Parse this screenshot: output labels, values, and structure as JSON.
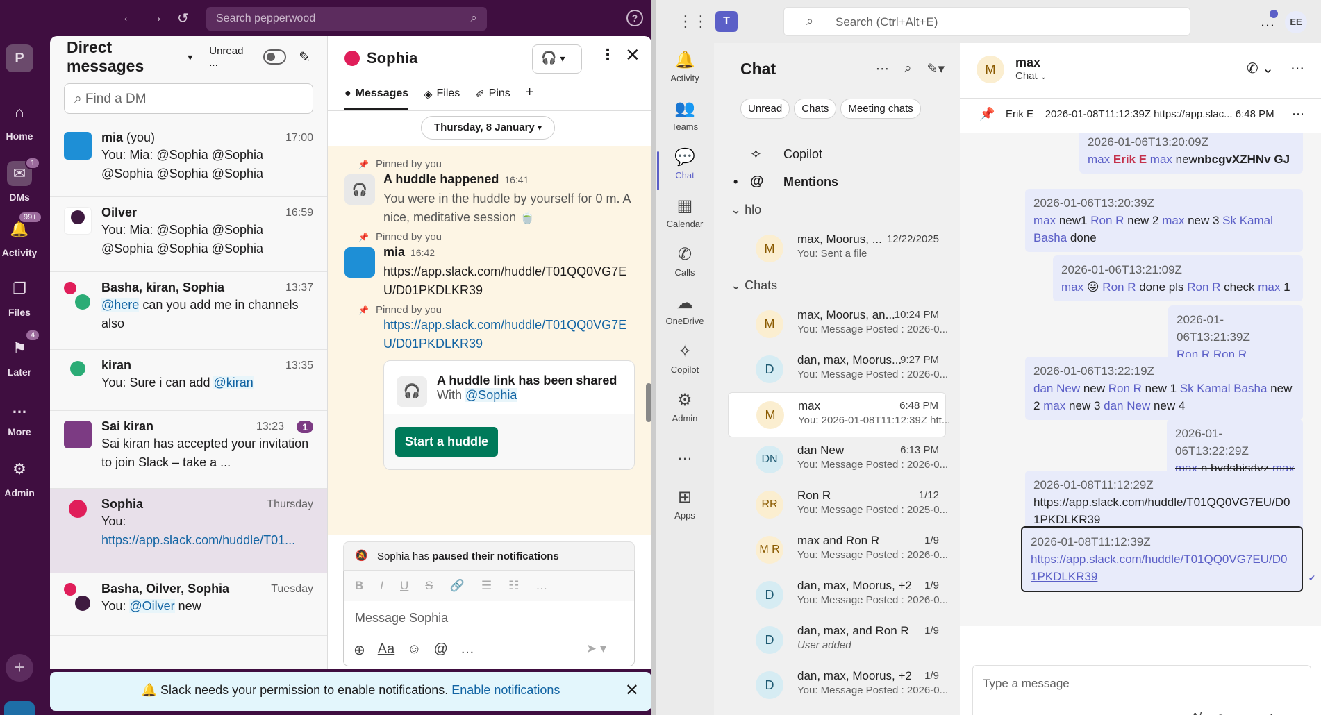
{
  "slack": {
    "search_placeholder": "Search pepperwood",
    "help": "?",
    "workspace_initial": "P",
    "rail": [
      {
        "label": "Home",
        "icon": "home-icon"
      },
      {
        "label": "DMs",
        "icon": "dms-icon",
        "badge": "1"
      },
      {
        "label": "Activity",
        "icon": "bell-icon",
        "badge": "99+"
      },
      {
        "label": "Files",
        "icon": "files-icon"
      },
      {
        "label": "Later",
        "icon": "bookmark-icon",
        "badge": "4"
      },
      {
        "label": "More",
        "icon": "more-icon"
      },
      {
        "label": "Admin",
        "icon": "gear-icon"
      }
    ],
    "dm": {
      "title": "Direct messages",
      "unread_label": "Unread ...",
      "find_placeholder": "Find a DM",
      "rows": [
        {
          "name": "mia",
          "name_suffix": " (you)",
          "time": "17:00",
          "text": "You: Mia: @Sophia @Sophia @Sophia @Sophia @Sophia"
        },
        {
          "name": "Oilver",
          "time": "16:59",
          "text": "You: Mia: @Sophia @Sophia @Sophia @Sophia @Sophia"
        },
        {
          "name": "Basha, kiran, Sophia",
          "time": "13:37",
          "mention": "@here",
          "text": " can you add me in channels also"
        },
        {
          "name": "kiran",
          "time": "13:35",
          "text": "You: Sure i can add ",
          "mention": "@kiran"
        },
        {
          "name": "Sai kiran",
          "time": "13:23",
          "badge": "1",
          "text": "Sai kiran has accepted your invitation to join Slack – take a ..."
        },
        {
          "name": "Sophia",
          "time": "Thursday",
          "text": "You:",
          "link": "https://app.slack.com/huddle/T01..."
        },
        {
          "name": "Basha, Oilver, Sophia",
          "time": "Tuesday",
          "text": "You: ",
          "mention": "@Oilver",
          "text2": " new"
        }
      ]
    },
    "conv": {
      "title": "Sophia",
      "tabs": [
        "Messages",
        "Files",
        "Pins"
      ],
      "add_tab": "+",
      "date": "Thursday, 8 January",
      "pinned_label": "Pinned by you",
      "huddle_msg": {
        "title": "A huddle happened",
        "time": "16:41",
        "text": "You were in the huddle by yourself for 0 m. A nice, meditative session 🍵"
      },
      "mia_msg": {
        "name": "mia",
        "time": "16:42",
        "text": "https://app.slack.com/huddle/T01QQ0VG7EU/D01PKDLKR39"
      },
      "link_msg": "https://app.slack.com/huddle/T01QQ0VG7EU/D01PKDLKR39",
      "card": {
        "title": "A huddle link has been shared",
        "with": "With ",
        "mention": "@Sophia",
        "button": "Start a huddle"
      },
      "paused_prefix": "Sophia has ",
      "paused_bold": "paused their notifications",
      "composer_placeholder": "Message Sophia"
    },
    "banner": {
      "text": "Slack needs your permission to enable notifications. ",
      "link": "Enable notifications"
    }
  },
  "teams": {
    "search_placeholder": "Search (Ctrl+Alt+E)",
    "me_initials": "EE",
    "rail": [
      "Activity",
      "Teams",
      "Chat",
      "Calendar",
      "Calls",
      "OneDrive",
      "Copilot",
      "Admin",
      "Apps"
    ],
    "list": {
      "title": "Chat",
      "pills": [
        "Unread",
        "Chats",
        "Meeting chats"
      ],
      "copilot": "Copilot",
      "mentions": "Mentions",
      "section_hlo": "hlo",
      "section_chats": "Chats",
      "hlo_chat": {
        "av": "M",
        "name": "max, Moorus, ...",
        "time": "12/22/2025",
        "prev": "You: Sent a file"
      },
      "chats": [
        {
          "av": "M",
          "name": "max, Moorus, an...",
          "time": "10:24 PM",
          "prev": "You: Message Posted : 2026-0..."
        },
        {
          "av": "D",
          "name": "dan, max, Moorus...",
          "time": "9:27 PM",
          "prev": "You: Message Posted : 2026-0..."
        },
        {
          "av": "M",
          "name": "max",
          "time": "6:48 PM",
          "prev": "You: 2026-01-08T11:12:39Z htt..."
        },
        {
          "av": "DN",
          "name": "dan New",
          "time": "6:13 PM",
          "prev": "You: Message Posted : 2026-0..."
        },
        {
          "av": "RR",
          "name": "Ron R",
          "time": "1/12",
          "prev": "You: Message Posted : 2025-0..."
        },
        {
          "av": "M R",
          "name": "max and Ron R",
          "time": "1/9",
          "prev": "You: Message Posted : 2026-0..."
        },
        {
          "av": "D",
          "name": "dan, max, Moorus, +2",
          "time": "1/9",
          "prev": "You: Message Posted : 2026-0..."
        },
        {
          "av": "D",
          "name": "dan, max, and Ron R",
          "time": "1/9",
          "prev": "User added"
        },
        {
          "av": "D",
          "name": "dan, max, Moorus, +2",
          "time": "1/9",
          "prev": "You: Message Posted : 2026-0..."
        }
      ]
    },
    "chat": {
      "name": "max",
      "sub": "Chat",
      "av": "M",
      "pin_author": "Erik E",
      "pin_text": "2026-01-08T11:12:39Z https://app.slac... 6:48 PM",
      "bubbles": {
        "b1_ts": "2026-01-06T13:20:09Z",
        "b2_ts": "2026-01-06T13:20:39Z",
        "b3_ts": "2026-01-06T13:21:09Z",
        "b4_ts": "2026-01-06T13:21:39Z",
        "b4_text": "Ron R Ron R hvdsghvjsv",
        "b5_ts": "2026-01-06T13:22:19Z",
        "b6_ts": "2026-01-06T13:22:29Z",
        "b7_ts": "2026-01-08T11:12:29Z",
        "b7_text": "https://app.slack.com/huddle/T01QQ0VG7EU/D01PKDLKR39",
        "b8_ts": "2026-01-08T11:12:39Z",
        "b8_link": "https://app.slack.com/huddle/T01QQ0VG7EU/D01PKDLKR39"
      },
      "compose_placeholder": "Type a message"
    }
  }
}
